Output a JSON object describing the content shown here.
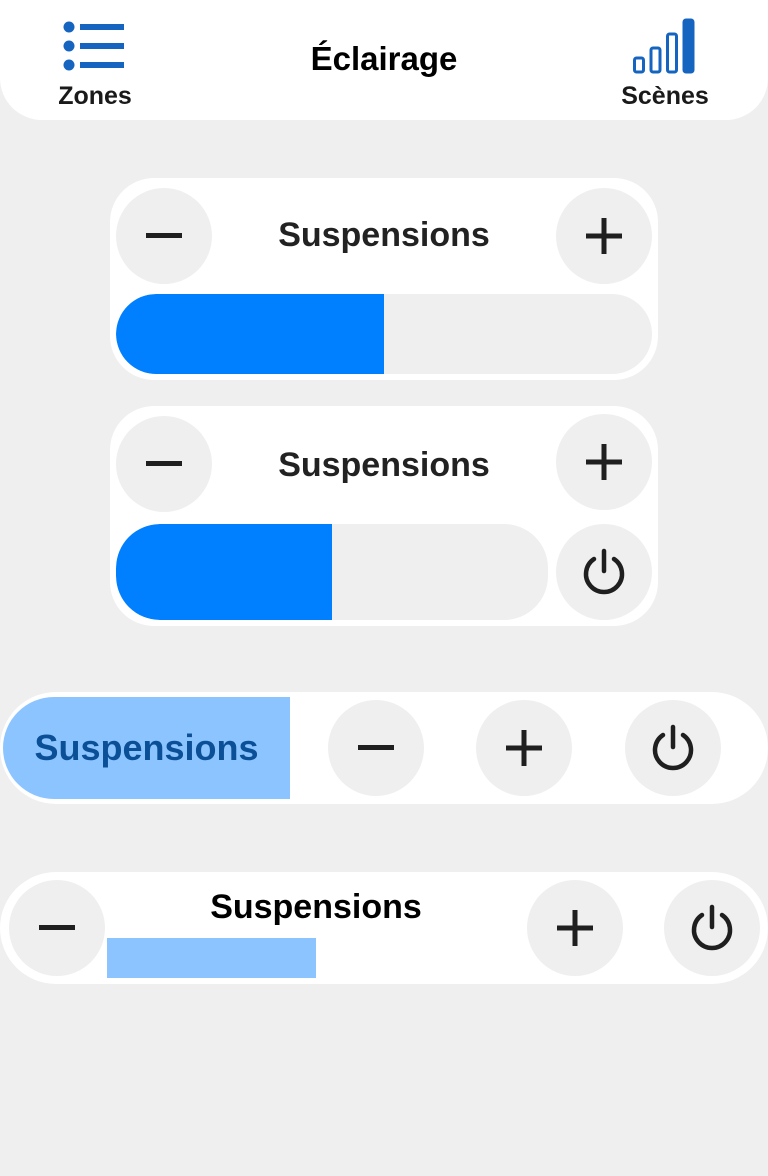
{
  "header": {
    "title": "Éclairage",
    "left_nav": {
      "label": "Zones",
      "icon": "list-icon"
    },
    "right_nav": {
      "label": "Scènes",
      "icon": "signal-bars-icon"
    }
  },
  "colors": {
    "accent": "#0080ff",
    "accent_light": "#8cc4ff",
    "nav_icon": "#1565c0",
    "background": "#efefef",
    "card": "#ffffff",
    "dark_text": "#0b4f96"
  },
  "cards": [
    {
      "title": "Suspensions",
      "level_percent": 50
    },
    {
      "title": "Suspensions",
      "level_percent": 50
    },
    {
      "title": "Suspensions"
    },
    {
      "title": "Suspensions",
      "level_percent": 50
    }
  ]
}
